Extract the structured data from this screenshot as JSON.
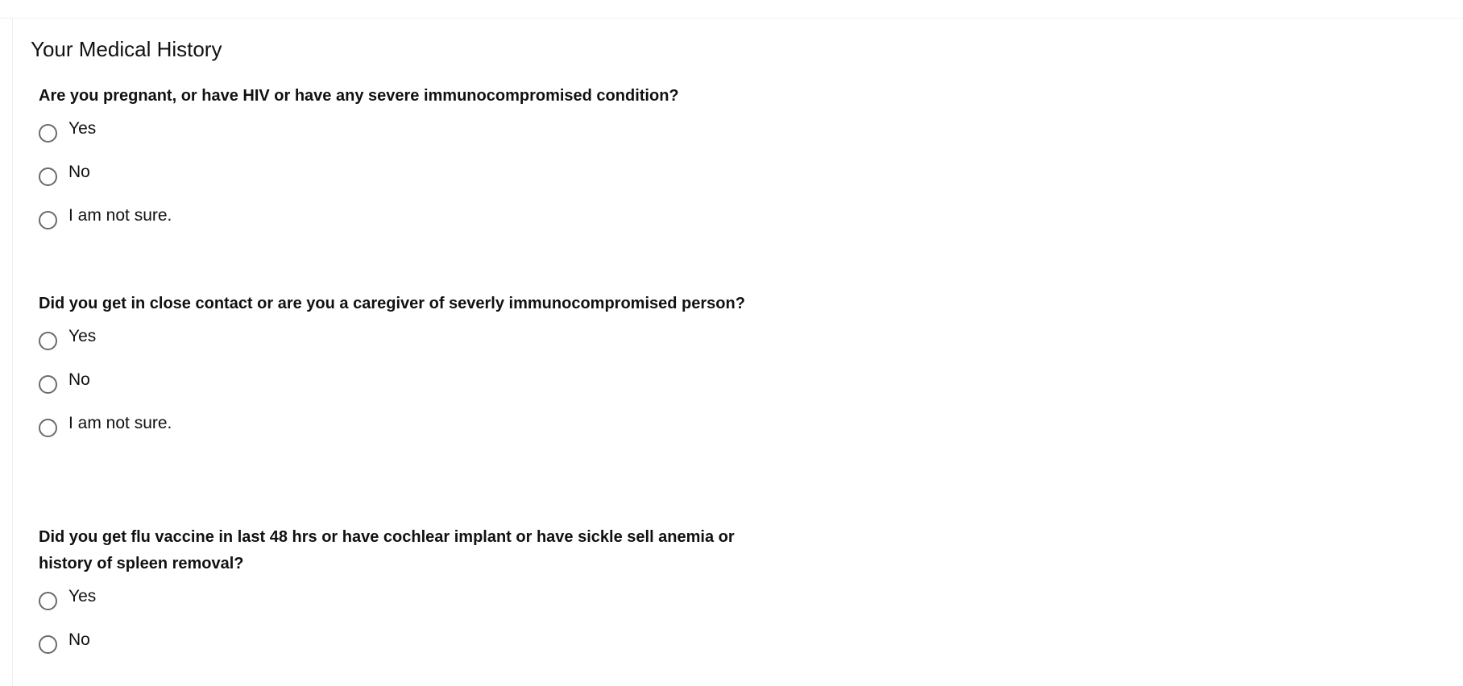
{
  "section": {
    "title": "Your Medical History"
  },
  "questions": [
    {
      "text": "Are you pregnant, or have HIV or have any severe immunocompromised condition?",
      "options": [
        "Yes",
        "No",
        "I am not sure."
      ]
    },
    {
      "text": "Did you get in close contact or are you a caregiver of severly immunocompromised person?",
      "options": [
        "Yes",
        "No",
        "I am not sure."
      ]
    },
    {
      "text": "Did you get flu vaccine in last 48 hrs or have cochlear implant or have sickle sell anemia or history of spleen removal?",
      "options": [
        "Yes",
        "No"
      ]
    }
  ]
}
